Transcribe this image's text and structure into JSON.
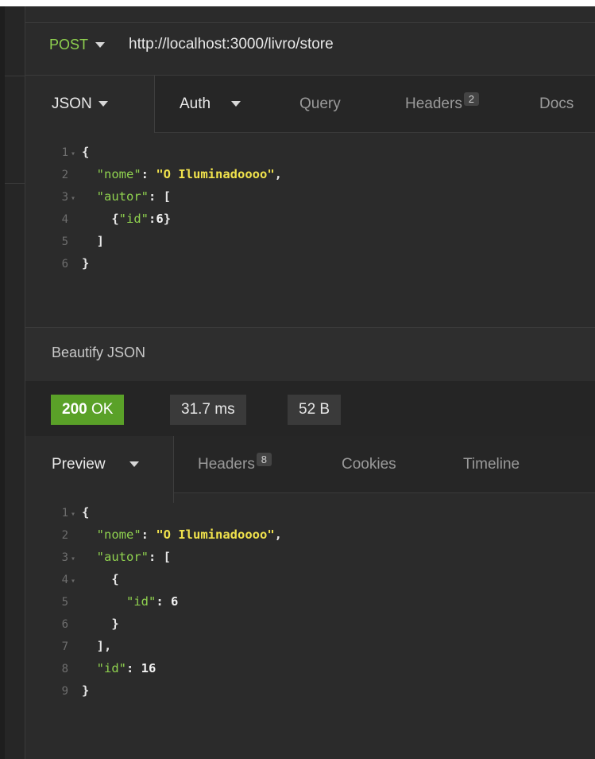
{
  "request": {
    "method": "POST",
    "url": "http://localhost:3000/livro/store",
    "tabs": {
      "body": "JSON",
      "auth": "Auth",
      "query": "Query",
      "headers": "Headers",
      "headers_count": "2",
      "docs": "Docs"
    },
    "body_lines": [
      {
        "n": "1",
        "folded": true,
        "text": "{"
      },
      {
        "n": "2",
        "key": "\"nome\"",
        "value": "\"O Iluminadoooo\""
      },
      {
        "n": "3",
        "folded": true,
        "key": "\"autor\"",
        "value": "["
      },
      {
        "n": "4",
        "key": "\"id\"",
        "value": "6"
      },
      {
        "n": "5",
        "text": "]"
      },
      {
        "n": "6",
        "text": "}"
      }
    ],
    "beautify_label": "Beautify JSON"
  },
  "response": {
    "status_code": "200",
    "status_text": "OK",
    "time": "31.7 ms",
    "size": "52 B",
    "tabs": {
      "preview": "Preview",
      "headers": "Headers",
      "headers_count": "8",
      "cookies": "Cookies",
      "timeline": "Timeline"
    },
    "body_lines": [
      {
        "n": "1",
        "folded": true,
        "text": "{"
      },
      {
        "n": "2",
        "key": "\"nome\"",
        "value": "\"O Iluminadoooo\""
      },
      {
        "n": "3",
        "folded": true,
        "key": "\"autor\"",
        "value": "["
      },
      {
        "n": "4",
        "folded": true,
        "text": "{"
      },
      {
        "n": "5",
        "key": "\"id\"",
        "value": "6"
      },
      {
        "n": "6",
        "text": "}"
      },
      {
        "n": "7",
        "text": "],"
      },
      {
        "n": "8",
        "key": "\"id\"",
        "value": "16"
      },
      {
        "n": "9",
        "text": "}"
      }
    ]
  },
  "colors": {
    "method": "#8fd14f",
    "key": "#8fd14f",
    "string": "#f0e24c",
    "status_ok": "#5aa128",
    "background": "#2b2b2b"
  },
  "icons": {
    "dropdown": "caret-down-icon",
    "fold": "fold-arrow-icon"
  }
}
